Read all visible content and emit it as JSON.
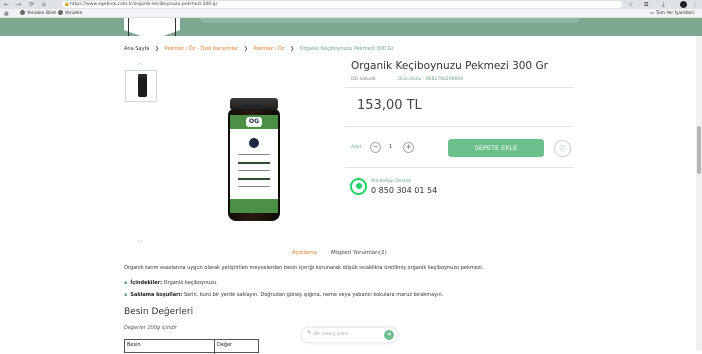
{
  "browser": {
    "url": "https://www.ogebink.com.tr/organik-keciboynuzu-pekmezi-300-gr",
    "nav": {
      "back": "←",
      "forward": "→",
      "reload": "⟳",
      "home": "⌂"
    },
    "bookmarks": [
      {
        "label": "Yeniden Bilet"
      },
      {
        "label": "Yeniden"
      }
    ],
    "other_bookmarks": "Tüm Yer İşaretleri"
  },
  "breadcrumb": [
    {
      "label": "Ana Sayfa"
    },
    {
      "label": "Pekmez / Öz - Özel Karışımlar"
    },
    {
      "label": "Pekmez / Öz"
    },
    {
      "label": "Organik Keçiboynuzu Pekmezi 300 Gr"
    }
  ],
  "breadcrumb_sep": "❯",
  "product": {
    "title": "Organik Keçiboynuzu Pekmezi 300 Gr",
    "brand": "OG natural",
    "sku": "Ürün Kodu : 8682792206660",
    "price": "153,00 TL",
    "jar_logo": "OG"
  },
  "cart": {
    "qty_label": "Adet",
    "minus": "−",
    "qty": "1",
    "plus": "+",
    "add_label": "SEPETE EKLE",
    "fav": "♡"
  },
  "whatsapp": {
    "label": "WhatsApp Destek",
    "phone": "0 850 304 01 54"
  },
  "tabs": [
    {
      "label": "Açıklama",
      "active": true
    },
    {
      "label": "Müşteri Yorumları(2)",
      "active": false
    }
  ],
  "description": {
    "text": "Organik tarım esaslarına uygun olarak yetiştirilen meyvelerden besin içeriği korunarak düşük sıcaklıkta üretilmiş organik keçiboynuzu pekmezi.",
    "items": [
      {
        "key": "İçindekiler:",
        "value": " Organik keçiboynuzu."
      },
      {
        "key": "Saklama koşulları:",
        "value": " Serin, kuru bir yerde saklayın. Doğrudan güneş ışığına, neme veya yabancı kokulara maruz bırakmayın."
      }
    ]
  },
  "nutrition": {
    "title": "Besin Değerleri",
    "subtitle": "Değerler 100g içindir",
    "headers": [
      "Besin",
      "Değer"
    ]
  },
  "search": {
    "placeholder": "Bir mesaj yazın"
  },
  "colors": {
    "accent_green": "#6dbf8e",
    "header_green": "#7ca892",
    "breadcrumb_orange": "#e07a2d"
  }
}
